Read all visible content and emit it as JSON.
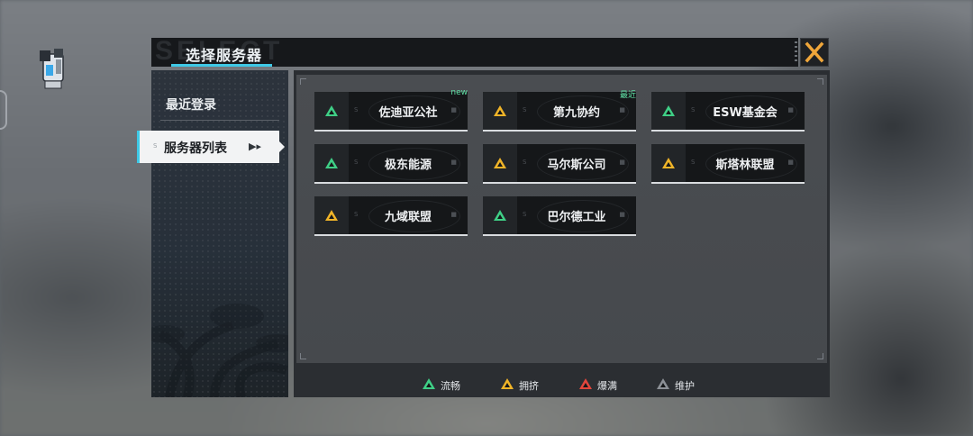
{
  "dialog": {
    "title": "选择服务器",
    "watermark": "SELECT"
  },
  "sidebar": {
    "items": [
      {
        "label": "最近登录"
      },
      {
        "label": "服务器列表",
        "active": true
      }
    ]
  },
  "servers": [
    {
      "name": "佐迪亚公社",
      "status": "green",
      "tag": "new"
    },
    {
      "name": "第九协约",
      "status": "yellow",
      "tag": "最近"
    },
    {
      "name": "ESW基金会",
      "status": "green",
      "tag": ""
    },
    {
      "name": "极东能源",
      "status": "green",
      "tag": ""
    },
    {
      "name": "马尔斯公司",
      "status": "yellow",
      "tag": ""
    },
    {
      "name": "斯塔林联盟",
      "status": "yellow",
      "tag": ""
    },
    {
      "name": "九域联盟",
      "status": "yellow",
      "tag": ""
    },
    {
      "name": "巴尔德工业",
      "status": "green",
      "tag": ""
    }
  ],
  "legend": [
    {
      "label": "流畅",
      "color": "#3fcf86"
    },
    {
      "label": "拥挤",
      "color": "#f0b428"
    },
    {
      "label": "爆满",
      "color": "#e2463c"
    },
    {
      "label": "维护",
      "color": "#8c9096"
    }
  ],
  "colors": {
    "accent": "#3ec9e6",
    "close": "#f0a63a",
    "green": "#3fcf86",
    "yellow": "#f0b428"
  }
}
